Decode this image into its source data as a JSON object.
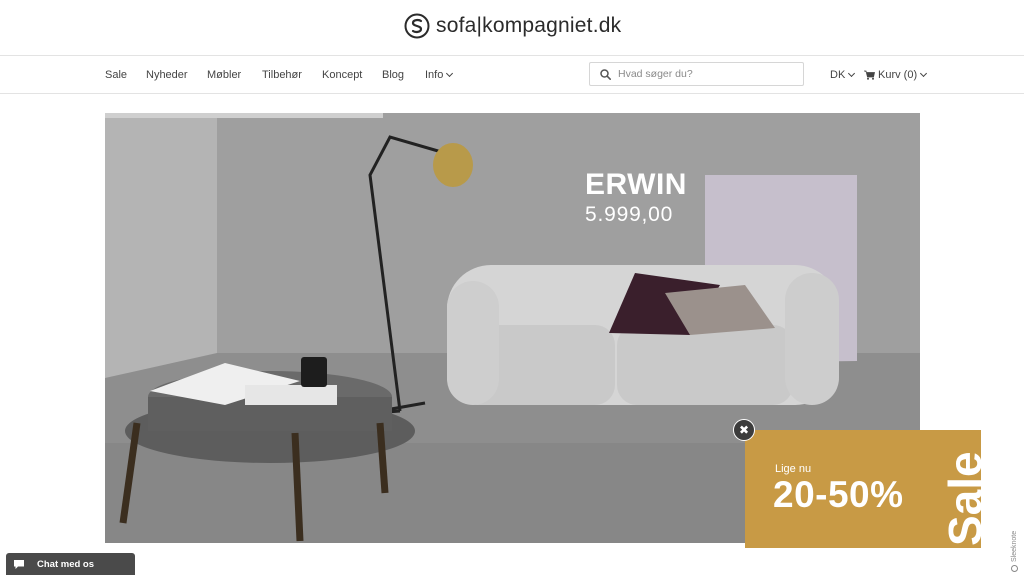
{
  "brand": {
    "name": "sofa|kompagniet.dk",
    "logo_icon": "s-circle-logo-icon"
  },
  "nav": {
    "items": [
      {
        "label": "Sale"
      },
      {
        "label": "Nyheder"
      },
      {
        "label": "Møbler"
      },
      {
        "label": "Tilbehør"
      },
      {
        "label": "Koncept"
      },
      {
        "label": "Blog"
      },
      {
        "label": "Info",
        "has_dropdown": true
      }
    ],
    "search": {
      "placeholder": "Hvad søger du?",
      "icon": "search-icon"
    },
    "language": {
      "label": "DK"
    },
    "cart": {
      "label": "Kurv (0)",
      "icon": "cart-icon"
    }
  },
  "hero": {
    "product_name": "ERWIN",
    "price": "5.999,00"
  },
  "sale_popup": {
    "small_text": "Lige nu",
    "big_text": "20-50%",
    "vertical_text": "Sale",
    "close_label": "✖",
    "background": "#c89a45"
  },
  "sleeknote": {
    "label": "Sleeknote"
  },
  "chat": {
    "label": "Chat med os",
    "icon": "chat-bubble-icon"
  },
  "colors": {
    "text": "#333333",
    "border": "#e3e3e3",
    "sale_gold": "#c89a45",
    "chat_bg": "#4a4a4a"
  }
}
